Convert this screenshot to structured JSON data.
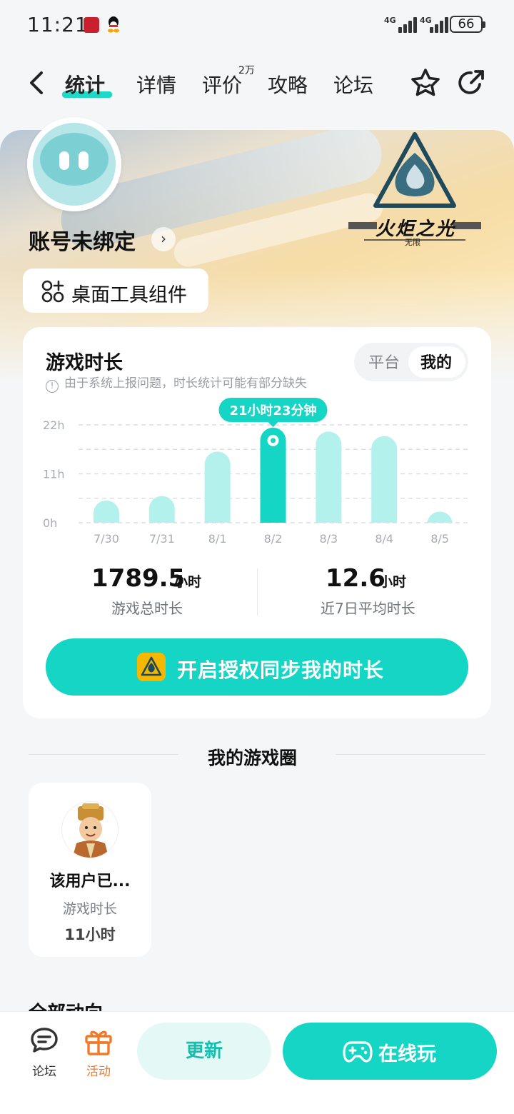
{
  "status_bar": {
    "time": "11:21",
    "signal1_label": "4G",
    "signal2_label": "4G",
    "battery": "66"
  },
  "header": {
    "tabs": [
      {
        "label": "统计",
        "active": true
      },
      {
        "label": "详情",
        "active": false
      },
      {
        "label": "评价",
        "active": false,
        "badge": "2万"
      },
      {
        "label": "攻略",
        "active": false
      },
      {
        "label": "论坛",
        "active": false
      }
    ],
    "icons": [
      "back-icon",
      "star-icon",
      "share-icon"
    ]
  },
  "profile": {
    "account_name": "账号未绑定",
    "widget_label": "桌面工具组件",
    "game_logo_text": "火炬之光",
    "game_logo_sub": "无限"
  },
  "stats_card": {
    "title": "游戏时长",
    "notice": "由于系统上报问题，时长统计可能有部分缺失",
    "segment": {
      "options": [
        "平台",
        "我的"
      ],
      "selected": "我的"
    },
    "total_value": "1789.5",
    "total_unit": "小时",
    "total_label": "游戏总时长",
    "avg_value": "12.6",
    "avg_unit": "小时",
    "avg_label": "近7日平均时长",
    "sync_button": "开启授权同步我的时长"
  },
  "chart_data": {
    "type": "bar",
    "categories": [
      "7/30",
      "7/31",
      "8/1",
      "8/2",
      "8/3",
      "8/4",
      "8/5"
    ],
    "values": [
      5,
      6,
      16,
      21.38,
      20.5,
      19.5,
      2.5
    ],
    "y_ticks": [
      "22h",
      "11h",
      "0h"
    ],
    "ylim": [
      0,
      22
    ],
    "grid": true,
    "highlight_index": 3,
    "highlight_label": "21小时23分钟",
    "colors": {
      "bar": "#b3f1ec",
      "highlight": "#15d6c5",
      "grid": "#dcdfe3",
      "tick": "#a8adb2"
    }
  },
  "game_circle": {
    "title": "我的游戏圈",
    "items": [
      {
        "name": "该用户已...",
        "sub": "游戏时长",
        "time": "11小时"
      }
    ]
  },
  "feed": {
    "title": "全部动向"
  },
  "bottom_bar": {
    "forum_label": "论坛",
    "activity_label": "活动",
    "update_label": "更新",
    "play_label": "在线玩"
  },
  "colors": {
    "accent": "#15d6c5",
    "accent_light": "#e4f8f6",
    "activity": "#f07a2c"
  }
}
